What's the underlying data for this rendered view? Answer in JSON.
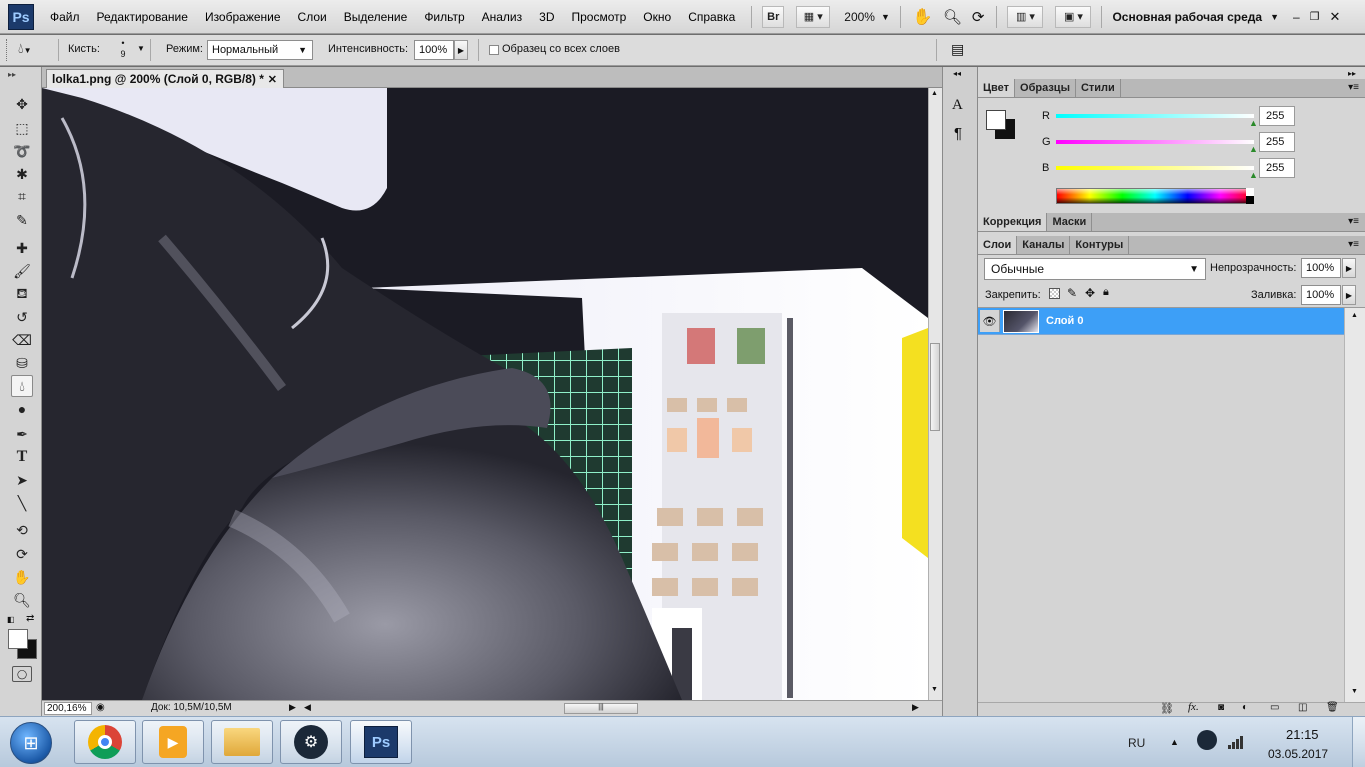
{
  "menubar": {
    "logo": "Ps",
    "items": [
      "Файл",
      "Редактирование",
      "Изображение",
      "Слои",
      "Выделение",
      "Фильтр",
      "Анализ",
      "3D",
      "Просмотр",
      "Окно",
      "Справка"
    ],
    "bridge_label": "Br",
    "zoom_value": "200%",
    "workspace": "Основная рабочая среда"
  },
  "options": {
    "brush_label": "Кисть:",
    "brush_size": "9",
    "mode_label": "Режим:",
    "mode_value": "Нормальный",
    "intensity_label": "Интенсивность:",
    "intensity_value": "100%",
    "sample_all_label": "Образец со всех слоев"
  },
  "document": {
    "tab_title": "lolka1.png @ 200% (Слой 0, RGB/8) *",
    "zoom_status": "200,16%",
    "doc_size": "Док: 10,5M/10,5M"
  },
  "color_panel": {
    "tabs": [
      "Цвет",
      "Образцы",
      "Стили"
    ],
    "channels": [
      {
        "label": "R",
        "value": "255"
      },
      {
        "label": "G",
        "value": "255"
      },
      {
        "label": "B",
        "value": "255"
      }
    ]
  },
  "adjust_panel": {
    "tabs": [
      "Коррекция",
      "Маски"
    ]
  },
  "layers_panel": {
    "tabs": [
      "Слои",
      "Каналы",
      "Контуры"
    ],
    "blend_mode": "Обычные",
    "opacity_label": "Непрозрачность:",
    "opacity_value": "100%",
    "lock_label": "Закрепить:",
    "fill_label": "Заливка:",
    "fill_value": "100%",
    "layer_name": "Слой 0"
  },
  "taskbar": {
    "lang": "RU",
    "time": "21:15",
    "date": "03.05.2017",
    "ps_label": "Ps"
  },
  "colors": {
    "selection_blue": "#3d9ff7",
    "ps_blue": "#1c3a6b",
    "panel_bg": "#d6d6d6"
  }
}
